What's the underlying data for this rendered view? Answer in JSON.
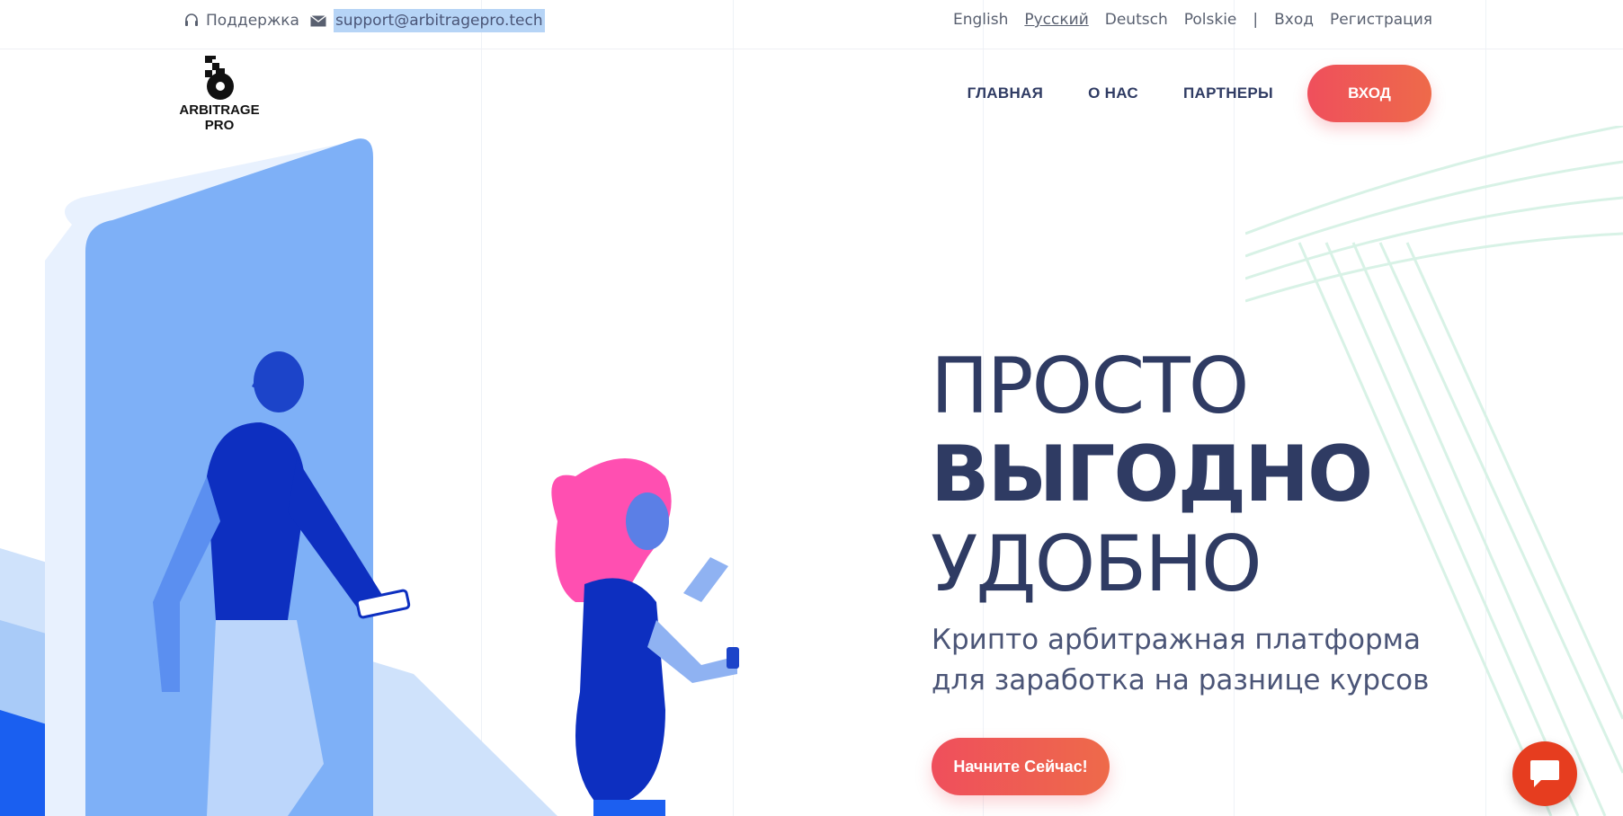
{
  "topbar": {
    "support_label": "Поддержка",
    "email": "support@arbitragepro.tech",
    "languages": [
      {
        "label": "English"
      },
      {
        "label": "Русский",
        "active": true
      },
      {
        "label": "Deutsch"
      },
      {
        "label": "Polskie"
      }
    ],
    "separator": "|",
    "login_link": "Вход",
    "register_link": "Регистрация"
  },
  "header": {
    "logo_text_line1": "ARBITRAGE",
    "logo_text_line2": "PRO",
    "nav": {
      "home": "ГЛАВНАЯ",
      "about": "О НАС",
      "partners": "ПАРТНЕРЫ"
    },
    "login_button": "ВХОД"
  },
  "hero": {
    "line1": "ПРОСТО",
    "line2": "ВЫГОДНО",
    "line3": "УДОБНО",
    "subtitle_line1": "Крипто арбитражная платформа",
    "subtitle_line2": "для заработка на разнице курсов",
    "cta": "Начните Сейчас!"
  },
  "colors": {
    "accent": "#ef5a55",
    "text_dark": "#2f3b63",
    "chat": "#e63d1f"
  }
}
